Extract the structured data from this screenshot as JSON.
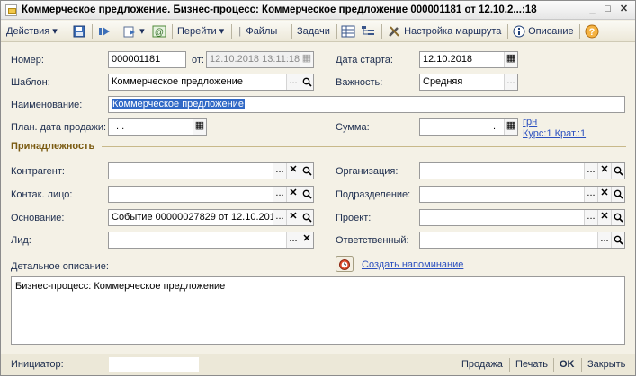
{
  "window": {
    "title": "Коммерческое предложение. Бизнес-процесс: Коммерческое предложение 000001181 от 12.10.2...:18"
  },
  "toolbar": {
    "actions_label": "Действия",
    "goto_label": "Перейти",
    "files_label": "Файлы",
    "tasks_label": "Задачи",
    "route_settings_label": "Настройка маршрута",
    "description_label": "Описание"
  },
  "header": {
    "number_label": "Номер:",
    "number_value": "000001181",
    "from_label": "от:",
    "from_value": "12.10.2018 13:11:18",
    "start_date_label": "Дата старта:",
    "start_date_value": "12.10.2018",
    "template_label": "Шаблон:",
    "template_value": "Коммерческое предложение",
    "importance_label": "Важность:",
    "importance_value": "Средняя",
    "name_label": "Наименование:",
    "name_value": "Коммерческое предложение",
    "plan_date_label": "План. дата продажи:",
    "plan_date_value": " .  .",
    "sum_label": "Сумма:",
    "sum_value": ".",
    "currency_link": "грн",
    "rate_link": "Курс:1 Крат.:1"
  },
  "belonging": {
    "section_title": "Принадлежность",
    "counterparty_label": "Контрагент:",
    "counterparty_value": "",
    "organization_label": "Организация:",
    "organization_value": "",
    "contact_label": "Контак. лицо:",
    "contact_value": "",
    "department_label": "Подразделение:",
    "department_value": "",
    "basis_label": "Основание:",
    "basis_value": "Событие 00000027829 от 12.10.201",
    "project_label": "Проект:",
    "project_value": "",
    "lead_label": "Лид:",
    "lead_value": "",
    "responsible_label": "Ответственный:",
    "responsible_value": ""
  },
  "details": {
    "label": "Детальное описание:",
    "reminder_link": "Создать напоминание",
    "text": "Бизнес-процесс: Коммерческое предложение"
  },
  "footer": {
    "initiator_label": "Инициатор:",
    "initiator_value": "",
    "sale_label": "Продажа",
    "print_label": "Печать",
    "ok_label": "OK",
    "close_label": "Закрыть"
  },
  "icons": {
    "dropdown": "▾",
    "ellipsis": "...",
    "clear": "✕",
    "search": "magnifier",
    "help": "?"
  }
}
